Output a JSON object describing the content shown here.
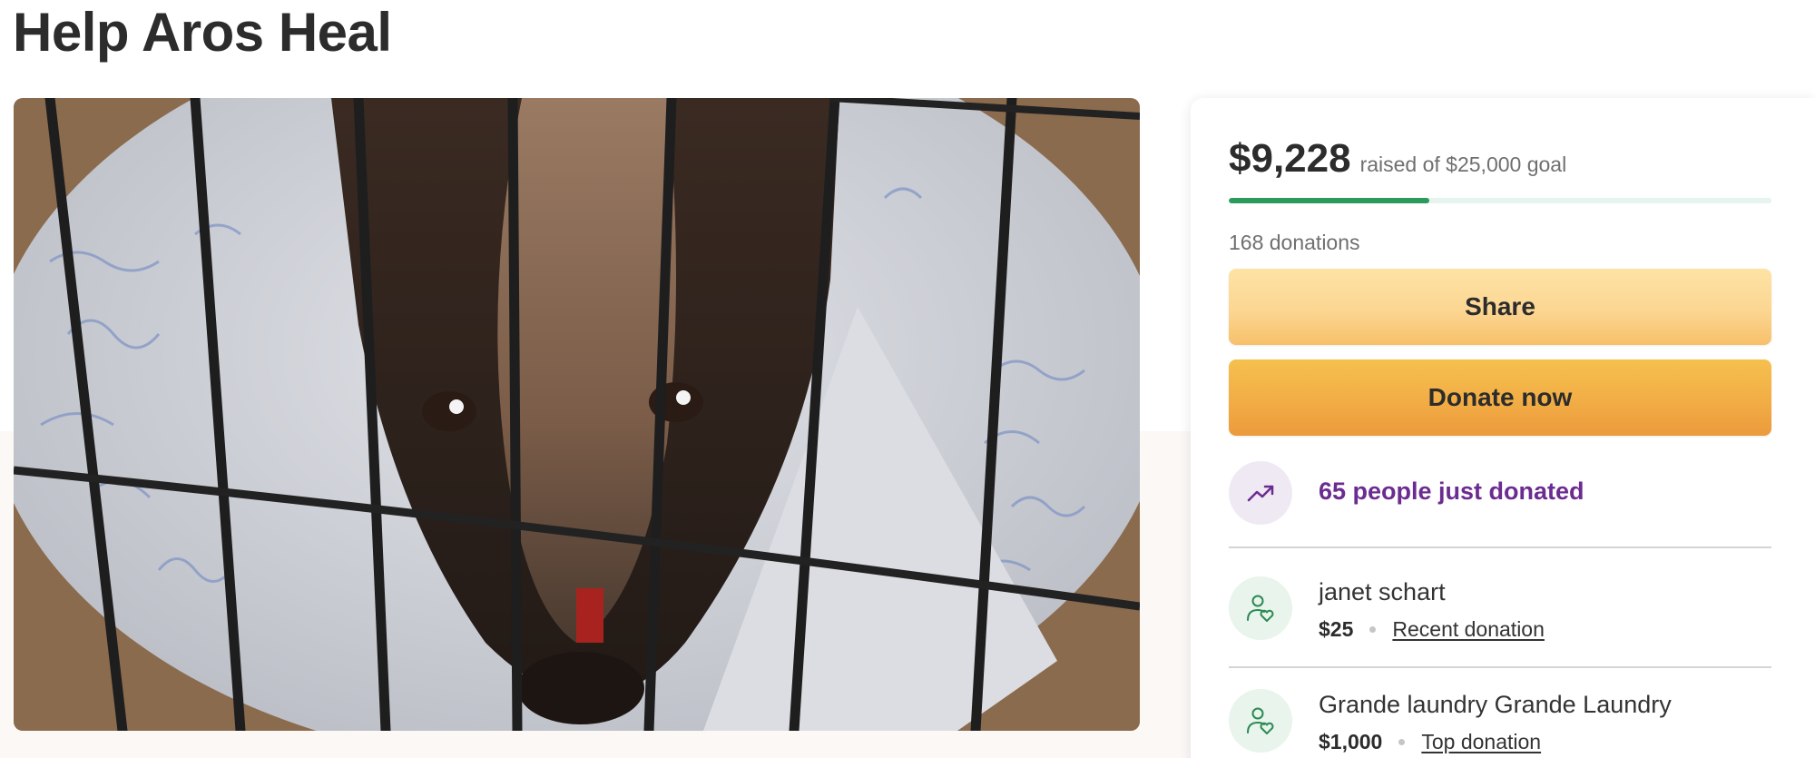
{
  "campaign": {
    "title": "Help Aros Heal",
    "photo_alt": "Dog wearing a cone behind cage bars"
  },
  "stats": {
    "raised": "$9,228",
    "goal_text": "raised of $25,000 goal",
    "progress_fraction": 0.369,
    "donations_count": "168 donations"
  },
  "actions": {
    "share_label": "Share",
    "donate_label": "Donate now"
  },
  "activity": {
    "icon": "trending-up-icon",
    "text": "65 people just donated"
  },
  "donors": [
    {
      "name": "janet schart",
      "amount": "$25",
      "tag": "Recent donation",
      "icon": "donor-heart-icon"
    },
    {
      "name": "Grande laundry Grande Laundry",
      "amount": "$1,000",
      "tag": "Top donation",
      "icon": "donor-heart-icon"
    }
  ],
  "colors": {
    "progress": "#2b9a5a",
    "progress_track": "#e6f4ee",
    "share_button": "#fcd692",
    "donate_button": "#f2ad45",
    "trend_text": "#6b2c91"
  }
}
